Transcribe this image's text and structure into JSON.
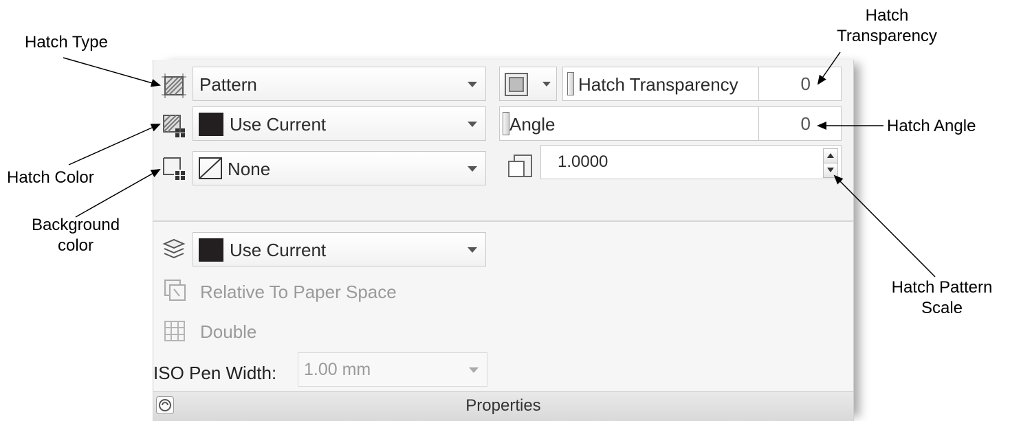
{
  "callouts": {
    "hatch_type": "Hatch Type",
    "hatch_transparency_line1": "Hatch",
    "hatch_transparency_line2": "Transparency",
    "hatch_angle": "Hatch Angle",
    "hatch_color": "Hatch Color",
    "background_color_line1": "Background",
    "background_color_line2": "color",
    "hatch_pattern_scale_line1": "Hatch Pattern",
    "hatch_pattern_scale_line2": "Scale"
  },
  "panel": {
    "hatch_type": "Pattern",
    "hatch_color": "Use Current",
    "background_color": "None",
    "transparency_label": "Hatch Transparency",
    "transparency_value": "0",
    "angle_label": "Angle",
    "angle_value": "0",
    "scale_value": "1.0000",
    "layer": "Use Current",
    "relative_to_paper_space": "Relative To Paper Space",
    "double": "Double",
    "iso_pen_width_label": "ISO Pen Width:",
    "iso_pen_width_value": "1.00 mm",
    "footer_title": "Properties"
  },
  "colors": {
    "swatch": "#231f20",
    "panel_bg": "#f0f0f0",
    "disabled_text": "#9a9a9a"
  },
  "icons": {
    "hatch_type": "hatch-type-icon",
    "hatch_color": "hatch-color-icon",
    "background_color": "hatch-background-icon",
    "transparency": "transparency-icon",
    "scale": "scale-icon",
    "layer": "layers-icon",
    "relative": "paper-space-icon",
    "double": "double-grid-icon",
    "footer": "dialog-launcher-icon"
  }
}
